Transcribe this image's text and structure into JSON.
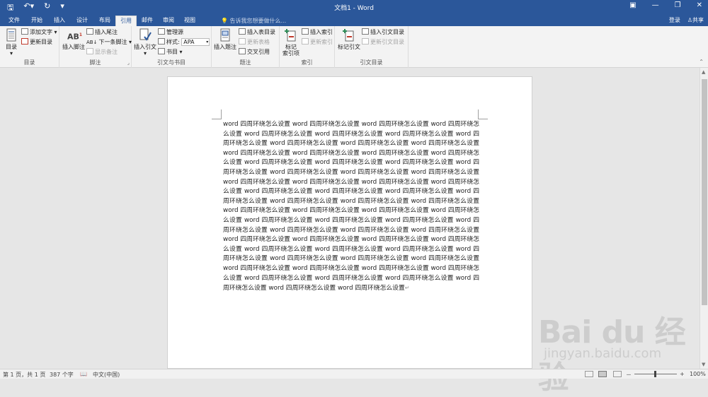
{
  "window": {
    "title": "文档1 - Word",
    "qat_icons": [
      "save-icon",
      "undo-icon",
      "redo-icon",
      "customize-icon"
    ]
  },
  "tabs": [
    "文件",
    "开始",
    "插入",
    "设计",
    "布局",
    "引用",
    "邮件",
    "审阅",
    "视图"
  ],
  "active_tab": "引用",
  "tell_me": "告诉我您想要做什么...",
  "account": {
    "login": "登录",
    "share": "共享"
  },
  "ribbon": {
    "toc": {
      "button": "目录",
      "add_text": "添加文字",
      "update": "更新目录",
      "label": "目录"
    },
    "footnotes": {
      "insert_footnote": "插入脚注",
      "insert_endnote": "插入尾注",
      "next_footnote": "下一条脚注",
      "show_notes": "显示备注",
      "label": "脚注"
    },
    "citations": {
      "insert_citation": "插入引文",
      "manage_sources": "管理源",
      "style_label": "样式:",
      "style_value": "APA",
      "bibliography": "书目",
      "label": "引文与书目"
    },
    "captions": {
      "insert_caption": "插入题注",
      "insert_table_of_figures": "插入表目录",
      "update_table": "更新表格",
      "cross_reference": "交叉引用",
      "label": "题注"
    },
    "index": {
      "mark_entry": "标记\n索引项",
      "insert_index": "插入索引",
      "update_index": "更新索引",
      "label": "索引"
    },
    "authorities": {
      "mark_citation": "标记引文",
      "insert_table": "插入引文目录",
      "update_table": "更新引文目录",
      "label": "引文目录"
    }
  },
  "document": {
    "body_text": "word 四周环绕怎么设置 word 四周环绕怎么设置 word 四周环绕怎么设置 word 四周环绕怎么设置 word 四周环绕怎么设置 word 四周环绕怎么设置 word 四周环绕怎么设置 word 四周环绕怎么设置 word 四周环绕怎么设置 word 四周环绕怎么设置 word 四周环绕怎么设置 word 四周环绕怎么设置 word 四周环绕怎么设置 word 四周环绕怎么设置 word 四周环绕怎么设置 word 四周环绕怎么设置 word 四周环绕怎么设置 word 四周环绕怎么设置 word 四周环绕怎么设置 word 四周环绕怎么设置 word 四周环绕怎么设置 word 四周环绕怎么设置 word 四周环绕怎么设置 word 四周环绕怎么设置 word 四周环绕怎么设置 word 四周环绕怎么设置 word 四周环绕怎么设置 word 四周环绕怎么设置 word 四周环绕怎么设置 word 四周环绕怎么设置 word 四周环绕怎么设置 word 四周环绕怎么设置 word 四周环绕怎么设置 word 四周环绕怎么设置 word 四周环绕怎么设置 word 四周环绕怎么设置 word 四周环绕怎么设置 word 四周环绕怎么设置 word 四周环绕怎么设置 word 四周环绕怎么设置 word 四周环绕怎么设置 word 四周环绕怎么设置 word 四周环绕怎么设置 word 四周环绕怎么设置 word 四周环绕怎么设置 word 四周环绕怎么设置 word 四周环绕怎么设置 word 四周环绕怎么设置 word 四周环绕怎么设置 word 四周环绕怎么设置 word 四周环绕怎么设置 word 四周环绕怎么设置 word 四周环绕怎么设置 word 四周环绕怎么设置 word 四周环绕怎么设置 word 四周环绕怎么设置 word 四周环绕怎么设置 word 四周环绕怎么设置 word 四周环绕怎么设置 word 四周环绕怎么设置 word 四周环绕怎么设置 word 四周环绕怎么设置 word 四周环绕怎么设置 word 四周环绕怎么设置 word 四周环绕怎么设置"
  },
  "status": {
    "page": "第 1 页，共 1 页",
    "words": "387 个字",
    "language": "中文(中国)",
    "zoom": "100%",
    "zoom_minus": "－",
    "zoom_plus": "+"
  },
  "watermark": {
    "brand": "Bai du 经验",
    "url": "jingyan.baidu.com"
  },
  "colors": {
    "accent": "#2b579a",
    "ribbon_bg": "#f3f3f3",
    "workspace": "#e6e6e6"
  }
}
